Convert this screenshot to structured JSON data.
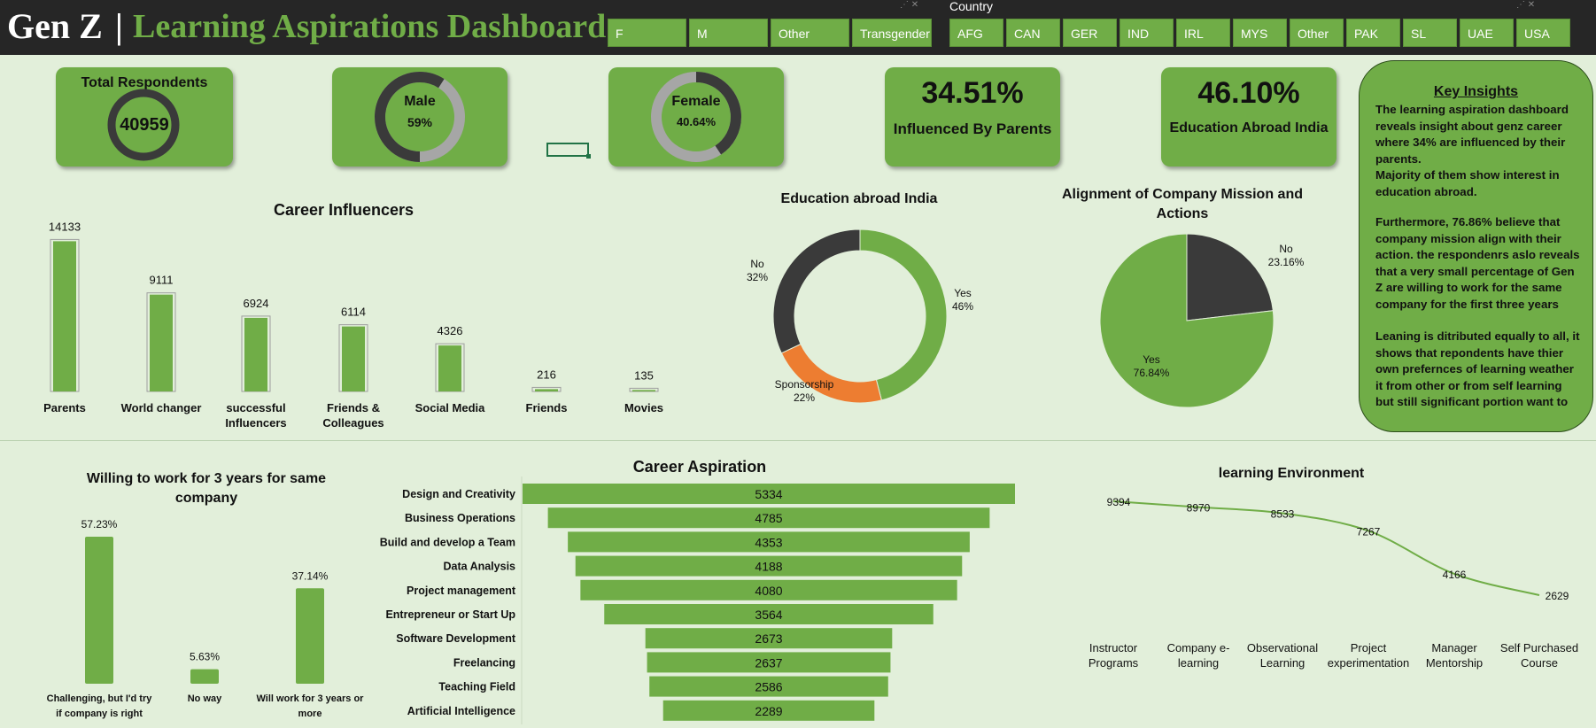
{
  "header": {
    "title_left": "Gen Z",
    "separator": "|",
    "title_main": "Learning Aspirations Dashboard",
    "gender_slicer": [
      "F",
      "M",
      "Other",
      "Transgender"
    ],
    "country_slicer_title": "Country",
    "country_slicer": [
      "AFG",
      "CAN",
      "GER",
      "IND",
      "IRL",
      "MYS",
      "Other",
      "PAK",
      "SL",
      "UAE",
      "USA"
    ]
  },
  "kpis": {
    "total": {
      "title": "Total Respondents",
      "value": "40959"
    },
    "male": {
      "title": "Male",
      "value": "59%",
      "fraction": 0.59
    },
    "female": {
      "title": "Female",
      "value": "40.64%",
      "fraction": 0.4064
    },
    "parents": {
      "value": "34.51%",
      "label": "Influenced By Parents"
    },
    "abroad": {
      "value": "46.10%",
      "label": "Education Abroad India"
    }
  },
  "insights": {
    "title": "Key Insights",
    "p1": "The learning aspiration dashboard reveals insight about genz career where 34% are influenced by their parents.\n Majority of them show interest in education abroad.",
    "p2": "Furthermore, 76.86% believe that company mission align with their action. the respondenrs aslo reveals that a very small percentage of Gen Z are willing to work for the same company for the first three years",
    "p3": "Leaning is ditributed equally to all, it shows that repondents have thier own prefernces of learning weather it from other  or from self learning but still significant portion want to"
  },
  "chart_data": [
    {
      "id": "career_influencers",
      "type": "bar",
      "title": "Career Influencers",
      "categories": [
        "Parents",
        "World changer",
        "successful Influencers",
        "Friends & Colleagues",
        "Social Media",
        "Friends",
        "Movies"
      ],
      "category_lines": [
        [
          "Parents"
        ],
        [
          "World changer"
        ],
        [
          "successful",
          "Influencers"
        ],
        [
          "Friends &",
          "Colleagues"
        ],
        [
          "Social Media"
        ],
        [
          "Friends"
        ],
        [
          "Movies"
        ]
      ],
      "values": [
        14133,
        9111,
        6924,
        6114,
        4326,
        216,
        135
      ],
      "color": "#70ad47"
    },
    {
      "id": "education_abroad",
      "type": "pie",
      "title": "Education abroad India",
      "slices": [
        {
          "label": "Yes",
          "value": 46,
          "text": "46%",
          "color": "#70ad47"
        },
        {
          "label": "Sponsorship",
          "value": 22,
          "text": "22%",
          "color": "#ed7d31"
        },
        {
          "label": "No",
          "value": 32,
          "text": "32%",
          "color": "#3a3a3a"
        }
      ]
    },
    {
      "id": "mission_alignment",
      "type": "pie",
      "title": "Alignment of Company Mission and Actions",
      "slices": [
        {
          "label": "No",
          "value": 23.16,
          "text": "23.16%",
          "color": "#3a3a3a"
        },
        {
          "label": "Yes",
          "value": 76.84,
          "text": "76.84%",
          "color": "#70ad47"
        }
      ]
    },
    {
      "id": "willing_3_years",
      "type": "bar",
      "title": "Willing to work for 3 years for same company",
      "categories": [
        "Challenging, but I'd try if company is right",
        "No way",
        "Will work for 3 years or more"
      ],
      "category_lines": [
        [
          "Challenging, but I'd try",
          "if company is right"
        ],
        [
          "No way"
        ],
        [
          "Will work for 3 years or",
          "more"
        ]
      ],
      "values": [
        57.23,
        5.63,
        37.14
      ],
      "value_labels": [
        "57.23%",
        "5.63%",
        "37.14%"
      ],
      "color": "#70ad47"
    },
    {
      "id": "career_aspiration",
      "type": "bar",
      "orientation": "horizontal-funnel",
      "title": "Career Aspiration",
      "categories": [
        "Design and Creativity",
        "Business Operations",
        "Build and develop a Team",
        "Data Analysis",
        "Project management",
        "Entrepreneur or Start Up",
        "Software Development",
        "Freelancing",
        "Teaching Field",
        "Artificial Intelligence"
      ],
      "values": [
        5334,
        4785,
        4353,
        4188,
        4080,
        3564,
        2673,
        2637,
        2586,
        2289
      ],
      "color": "#70ad47"
    },
    {
      "id": "learning_environment",
      "type": "line",
      "title": "learning Environment",
      "categories": [
        "Instructor Programs",
        "Company e-learning",
        "Observational Learning",
        "Project experimentation",
        "Manager Mentorship",
        "Self Purchased Course"
      ],
      "category_lines": [
        [
          "Instructor",
          "Programs"
        ],
        [
          "Company e-",
          "learning"
        ],
        [
          "Observational",
          "Learning"
        ],
        [
          "Project",
          "experimentation"
        ],
        [
          "Manager",
          "Mentorship"
        ],
        [
          "Self Purchased",
          "Course"
        ]
      ],
      "values": [
        9394,
        8970,
        8533,
        7267,
        4166,
        2629
      ],
      "color": "#70ad47"
    }
  ]
}
